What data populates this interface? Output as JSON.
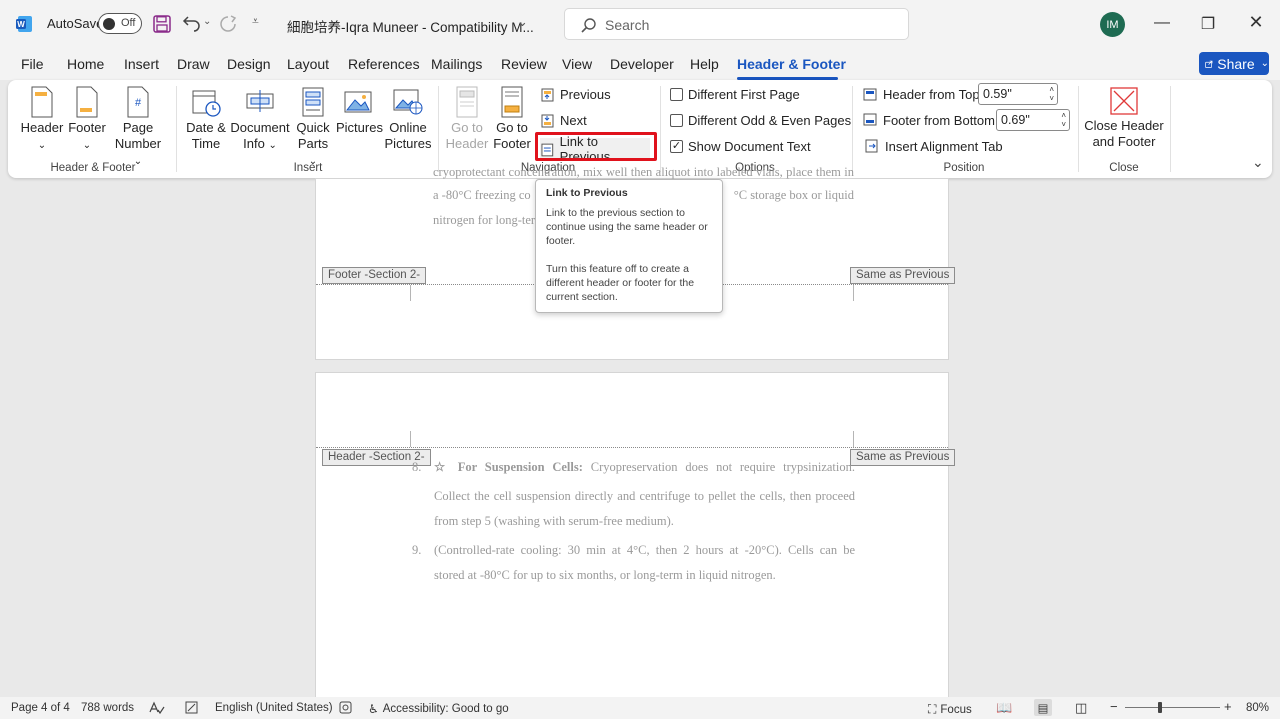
{
  "titlebar": {
    "autosave_label": "AutoSave",
    "autosave_state": "Off",
    "doc_title": "細胞培养-Iqra Muneer  -  Compatibility M...",
    "search_placeholder": "Search",
    "user_initials": "IM"
  },
  "tabs": [
    "File",
    "Home",
    "Insert",
    "Draw",
    "Design",
    "Layout",
    "References",
    "Mailings",
    "Review",
    "View",
    "Developer",
    "Help",
    "Header & Footer"
  ],
  "share_label": "Share",
  "ribbon": {
    "header_footer_group": {
      "label": "Header & Footer",
      "header_l1": "Header",
      "footer_l1": "Footer",
      "page_number_l1": "Page",
      "page_number_l2": "Number"
    },
    "insert_group": {
      "label": "Insert",
      "date_l1": "Date &",
      "date_l2": "Time",
      "docinfo_l1": "Document",
      "docinfo_l2": "Info",
      "quick_l1": "Quick",
      "quick_l2": "Parts",
      "pictures": "Pictures",
      "online_l1": "Online",
      "online_l2": "Pictures"
    },
    "navigation_group": {
      "label": "Navigation",
      "goto_header_l1": "Go to",
      "goto_header_l2": "Header",
      "goto_footer_l1": "Go to",
      "goto_footer_l2": "Footer",
      "previous": "Previous",
      "next": "Next",
      "link_to_previous": "Link to Previous"
    },
    "options_group": {
      "label": "Options",
      "different_first": "Different First Page",
      "different_odd_even": "Different Odd & Even Pages",
      "show_doc_text": "Show Document Text",
      "show_doc_text_checked": true
    },
    "position_group": {
      "label": "Position",
      "header_from_top_label": "Header from Top:",
      "header_from_top_value": "0.59\"",
      "footer_from_bottom_label": "Footer from Bottom:",
      "footer_from_bottom_value": "0.69\"",
      "insert_alignment_tab": "Insert Alignment Tab"
    },
    "close_group": {
      "label": "Close",
      "close_l1": "Close Header",
      "close_l2": "and Footer"
    }
  },
  "tooltip": {
    "title": "Link to Previous",
    "para1": "Link to the previous section to continue using the same header or footer.",
    "para2": "Turn this feature off to create a different header or footer for the current section."
  },
  "document": {
    "page1_line0": "cryoprotectant concentration, mix well then aliquot into labeled vials, place them in",
    "page1_line1_left": "a -80°C freezing co",
    "page1_line1_right": "°C storage box or liquid",
    "page1_line2": "nitrogen for long-ter",
    "footer_tag": "Footer -Section 2-",
    "same_as_previous_1": "Same as Previous",
    "header_tag": "Header -Section 2-",
    "same_as_previous_2": "Same as Previous",
    "item8_num": "8.",
    "item8_bold": "☆ For Suspension Cells:",
    "item8_rest": " Cryopreservation does not require trypsinization.",
    "item8_line2": "Collect the cell suspension directly and centrifuge to pellet the cells, then proceed",
    "item8_line3": "from step 5 (washing with serum-free medium).",
    "item9_num": "9.",
    "item9_line1": "(Controlled-rate cooling: 30 min at 4°C, then 2 hours at -20°C). Cells can be",
    "item9_line2": "stored at -80°C for up to six months, or long-term in liquid nitrogen."
  },
  "statusbar": {
    "page": "Page 4 of 4",
    "words": "788 words",
    "language": "English (United States)",
    "accessibility": "Accessibility: Good to go",
    "focus": "Focus",
    "zoom": "80%",
    "zoom_fraction": 0.8
  },
  "colors": {
    "accent": "#1a56c0",
    "highlight": "#e0121c",
    "close_icon": "#e03a3a"
  }
}
